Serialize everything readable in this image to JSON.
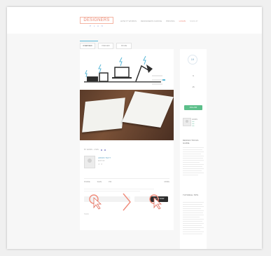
{
  "header": {
    "logo_text": "DESIGNERS",
    "logo_sub": "P L A N",
    "nav": [
      "HOW IT WORKS",
      "DESIGNERS CHOICE",
      "PRICING",
      "LOGIN"
    ],
    "nav_last": "SIGNUP"
  },
  "tabs": [
    "OVERVIEW",
    "PREVIEW",
    "SHARE"
  ],
  "post": {
    "meta": "BY ADMIN · 2 MIN",
    "author_name": "ADMIN TEXT",
    "author_role": "EDITOR",
    "author_stars": "★★",
    "actions_left": [
      "SHARE",
      "SAVE",
      "PIN"
    ],
    "actions_right": "MORE",
    "demo_button": "BUY IT NOW",
    "footer": "TAGS"
  },
  "sidebar": {
    "stat1": "19",
    "stat2": "9",
    "stat3": "15",
    "button": "FOLLOW",
    "card_name": "ADMIN",
    "card_links": [
      "Link",
      "Link",
      "Link"
    ],
    "heading1": "DESIGN TOOLS GUIDE",
    "heading2": "TUTORIAL TIPS"
  },
  "colors": {
    "accent": "#5bb8d8",
    "brand": "#e8846f",
    "green": "#5cbf8a"
  }
}
